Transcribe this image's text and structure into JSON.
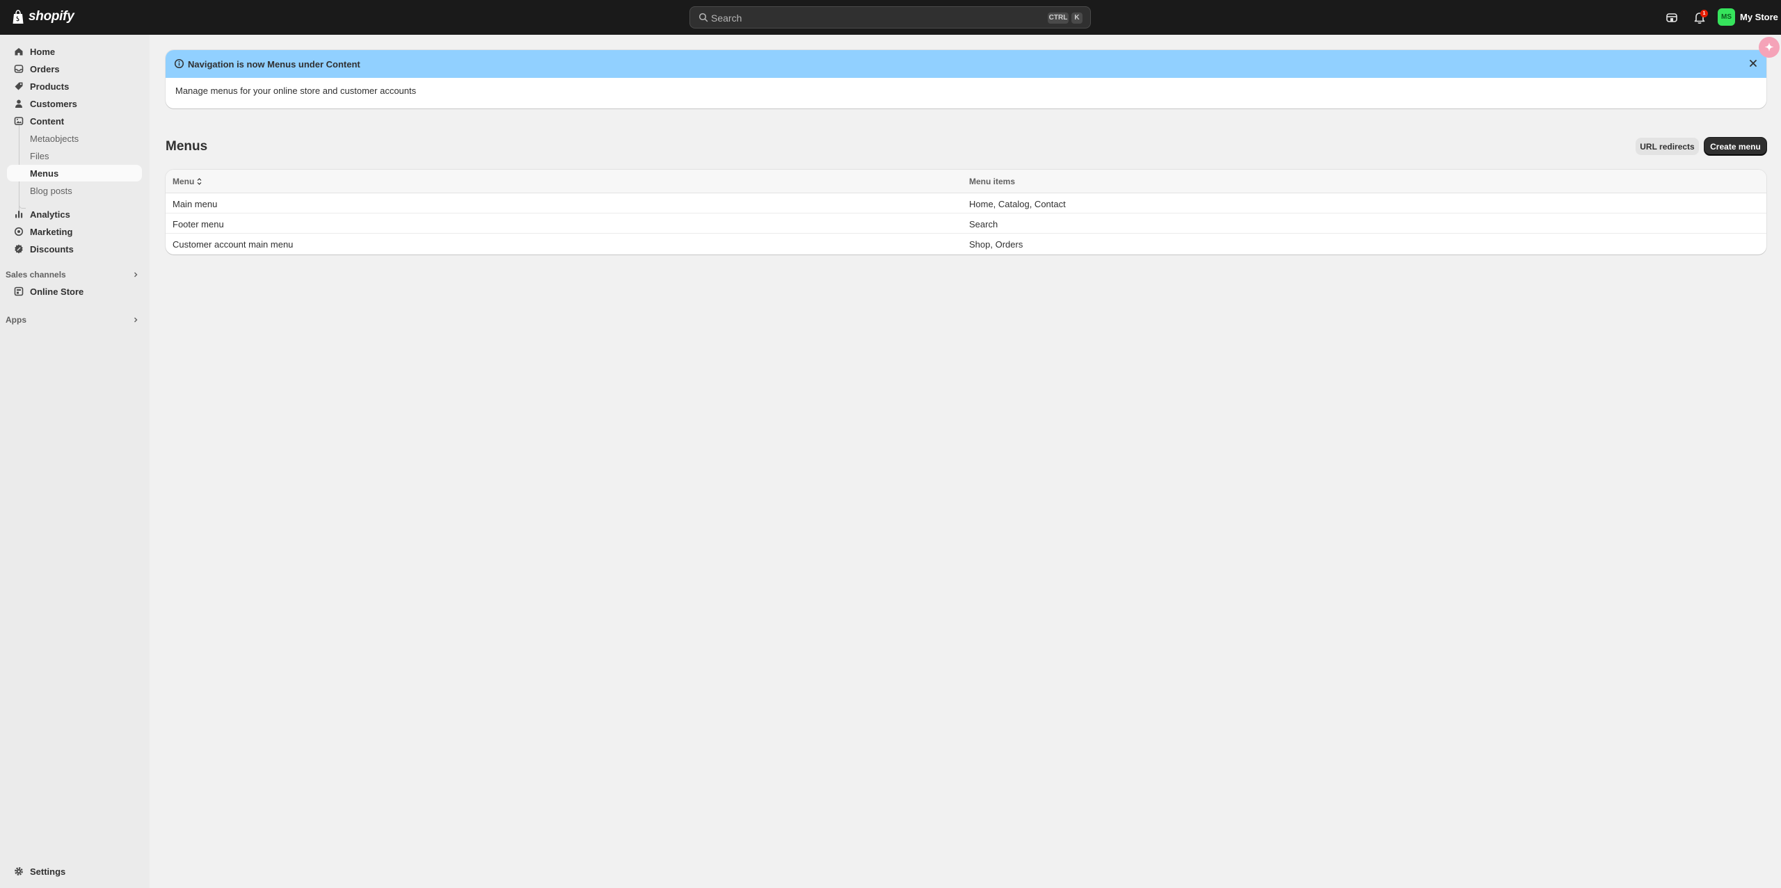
{
  "topbar": {
    "logo_text": "shopify",
    "search_placeholder": "Search",
    "shortcut_ctrl": "CTRL",
    "shortcut_k": "K",
    "notification_count": "1",
    "avatar_initials": "MS",
    "store_name": "My Store"
  },
  "sidebar": {
    "items": [
      {
        "label": "Home",
        "icon": "home-icon"
      },
      {
        "label": "Orders",
        "icon": "inbox-icon"
      },
      {
        "label": "Products",
        "icon": "tag-icon"
      },
      {
        "label": "Customers",
        "icon": "person-icon"
      },
      {
        "label": "Content",
        "icon": "content-icon"
      }
    ],
    "content_sub": [
      "Metaobjects",
      "Files",
      "Menus",
      "Blog posts"
    ],
    "items2": [
      {
        "label": "Analytics",
        "icon": "analytics-icon"
      },
      {
        "label": "Marketing",
        "icon": "target-icon"
      },
      {
        "label": "Discounts",
        "icon": "discount-icon"
      }
    ],
    "sales_channels_label": "Sales channels",
    "online_store_label": "Online Store",
    "apps_label": "Apps",
    "settings_label": "Settings"
  },
  "banner": {
    "title": "Navigation is now Menus under Content",
    "body": "Manage menus for your online store and customer accounts"
  },
  "page": {
    "title": "Menus",
    "url_redirects": "URL redirects",
    "create_menu": "Create menu"
  },
  "table": {
    "headers": [
      "Menu",
      "Menu items"
    ],
    "rows": [
      [
        "Main menu",
        "Home, Catalog, Contact"
      ],
      [
        "Footer menu",
        "Search"
      ],
      [
        "Customer account main menu",
        "Shop, Orders"
      ]
    ]
  },
  "colors": {
    "topbar": "#1a1a1a",
    "banner_header": "#91d0ff",
    "primary_button": "#303030",
    "avatar": "#36e35c"
  }
}
